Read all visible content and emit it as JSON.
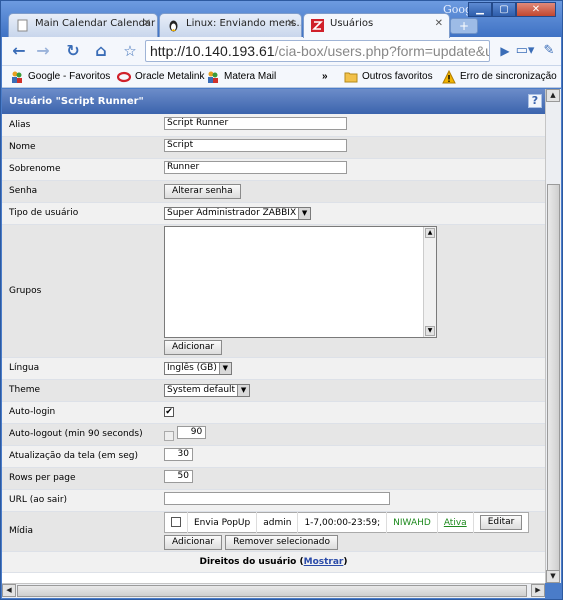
{
  "browser": {
    "google_label": "Google",
    "tabs": [
      {
        "label": "Main Calendar Calendar"
      },
      {
        "label": "Linux: Enviando mens…"
      },
      {
        "label": "Usuários"
      }
    ],
    "new_tab_label": "+",
    "url_host": "http://10.140.193.61",
    "url_path": "/cia-box/users.php?form=update&use",
    "bookmarks": [
      {
        "label": "Google - Favoritos"
      },
      {
        "label": "Oracle Metalink"
      },
      {
        "label": "Matera Mail"
      }
    ],
    "bookmarks_overflow": "»",
    "other_bookmarks": "Outros favoritos",
    "sync_error": "Erro de sincronização"
  },
  "page": {
    "header_title": "Usuário \"Script Runner\"",
    "help": "?",
    "fields": {
      "alias_label": "Alias",
      "alias_value": "Script Runner",
      "name_label": "Nome",
      "name_value": "Script",
      "surname_label": "Sobrenome",
      "surname_value": "Runner",
      "password_label": "Senha",
      "password_button": "Alterar senha",
      "user_type_label": "Tipo de usuário",
      "user_type_value": "Super Administrador ZABBIX",
      "groups_label": "Grupos",
      "groups_add": "Adicionar",
      "language_label": "Língua",
      "language_value": "Inglês (GB)",
      "theme_label": "Theme",
      "theme_value": "System default",
      "autologin_label": "Auto-login",
      "autologin_checked": "✔",
      "autologout_label": "Auto-logout (min 90 seconds)",
      "autologout_value": "90",
      "refresh_label": "Atualização da tela (em seg)",
      "refresh_value": "30",
      "rows_label": "Rows per page",
      "rows_value": "50",
      "url_label": "URL (ao sair)",
      "url_value": "",
      "media_label": "Mídia",
      "media_row": {
        "type": "Envia PopUp",
        "sendto": "admin",
        "period": "1-7,00:00-23:59;",
        "severity": "NIWAHD",
        "status": "Ativa",
        "edit": "Editar"
      },
      "media_add": "Adicionar",
      "media_remove": "Remover selecionado",
      "rights_label": "Direitos do usuário (",
      "rights_link": "Mostrar",
      "rights_close": ")"
    }
  },
  "colors": {
    "header_blue": "#3b64ad",
    "status_green": "#1e8a1e",
    "link_blue": "#2a4aa8"
  }
}
